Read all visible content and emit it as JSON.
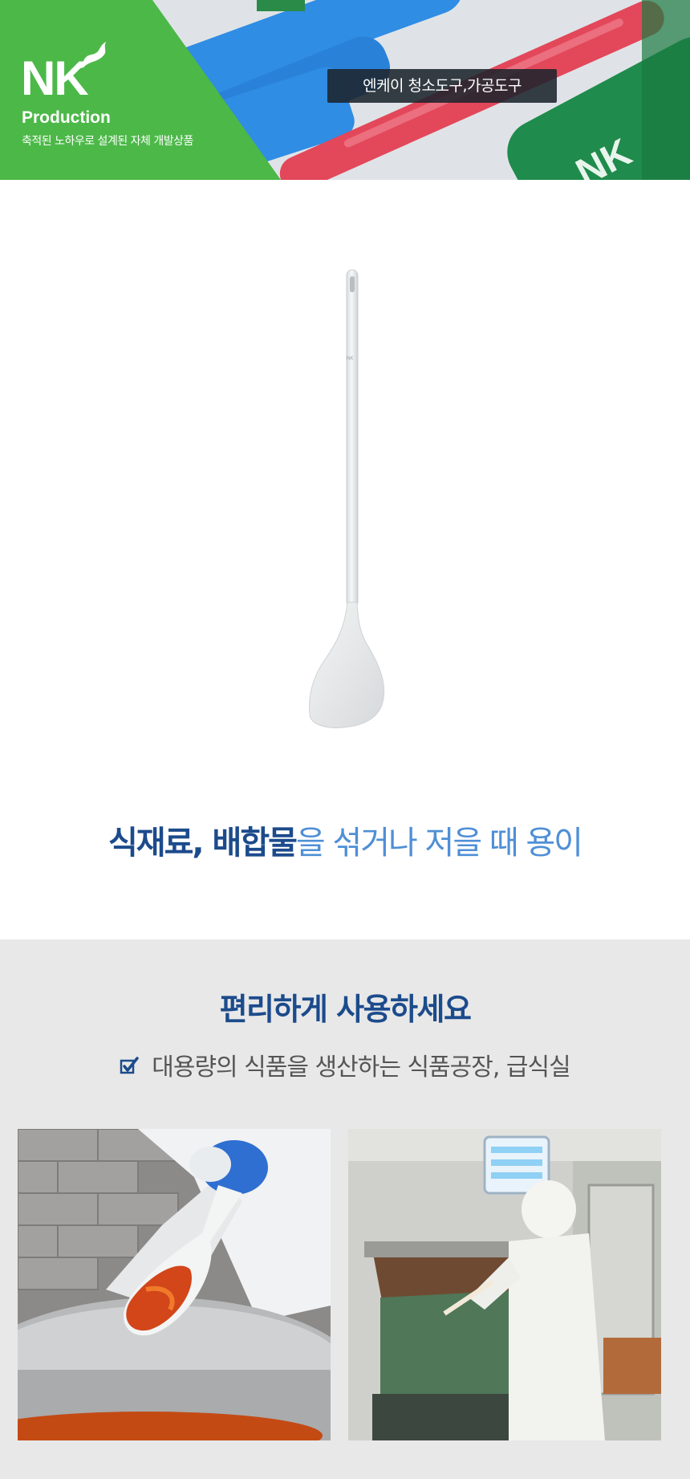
{
  "banner": {
    "brand": "NK",
    "brand_sub": "Production",
    "tagline": "축적된 노하우로 설계된 자체 개발상품",
    "category_badge": "엔케이 청소도구,가공도구",
    "colors": {
      "green": "#4cb848",
      "blue": "#2f8de4",
      "red": "#e3475a",
      "dark_green": "#1f8b4c"
    }
  },
  "product": {
    "headline_strong": "식재료, 배합물",
    "headline_light": "을 섞거나 저을 때 용이"
  },
  "usage": {
    "title": "편리하게 사용하세요",
    "item": "대용량의 식품을 생산하는 식품공장, 급식실",
    "check_icon": "checkbox-checked-icon"
  }
}
